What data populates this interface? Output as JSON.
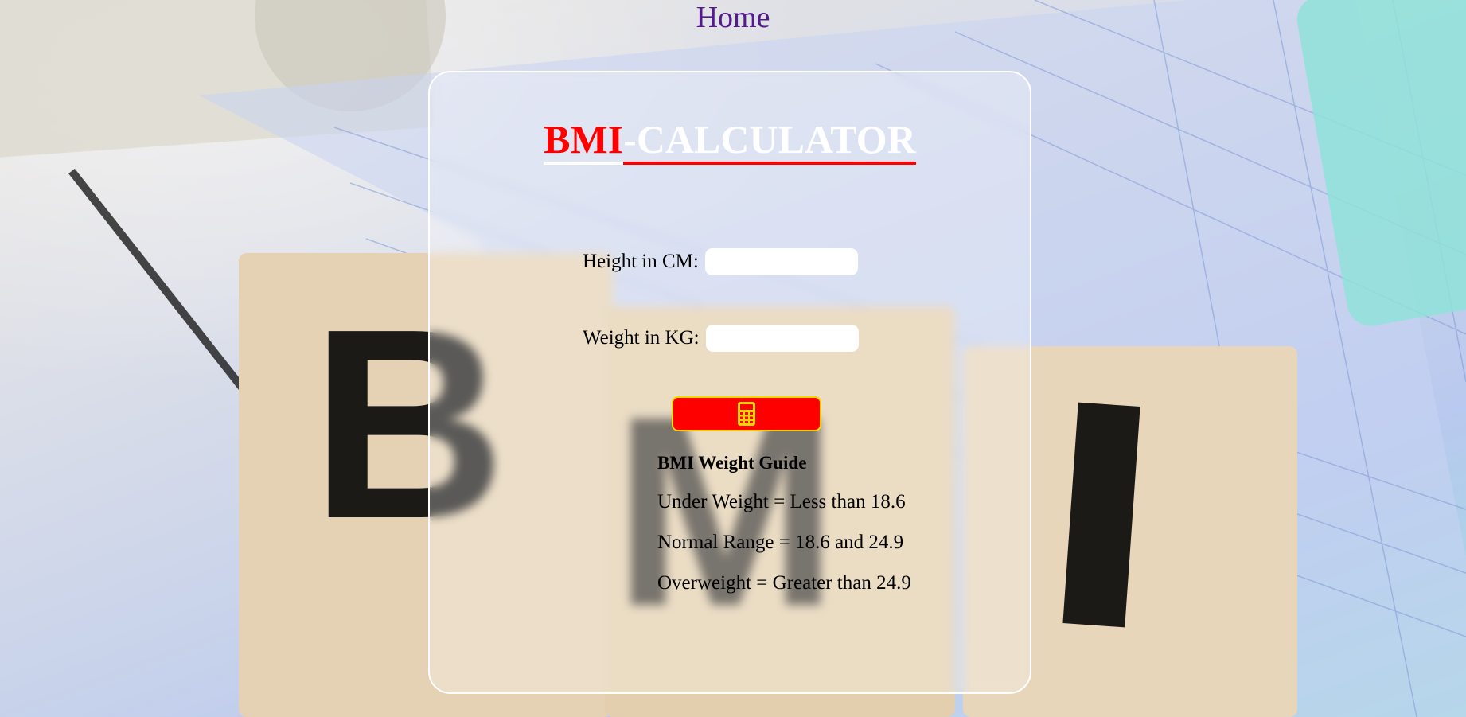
{
  "nav": {
    "home_label": "Home"
  },
  "calculator": {
    "title_accent": "BMI",
    "title_main": "-CALCULATOR",
    "height_label": "Height in CM:",
    "height_value": "",
    "weight_label": "Weight in KG:",
    "weight_value": "",
    "calculate_icon": "calculator-icon"
  },
  "guide": {
    "title": "BMI Weight Guide",
    "lines": [
      "Under Weight = Less than 18.6",
      "Normal Range = 18.6 and 24.9",
      "Overweight = Greater than 24.9"
    ]
  },
  "colors": {
    "accent": "#ff0000",
    "button_border": "#ffd700",
    "icon": "#ffd700",
    "link": "#551a8b"
  },
  "background": {
    "blocks_letters": [
      "B",
      "M",
      "I"
    ]
  }
}
